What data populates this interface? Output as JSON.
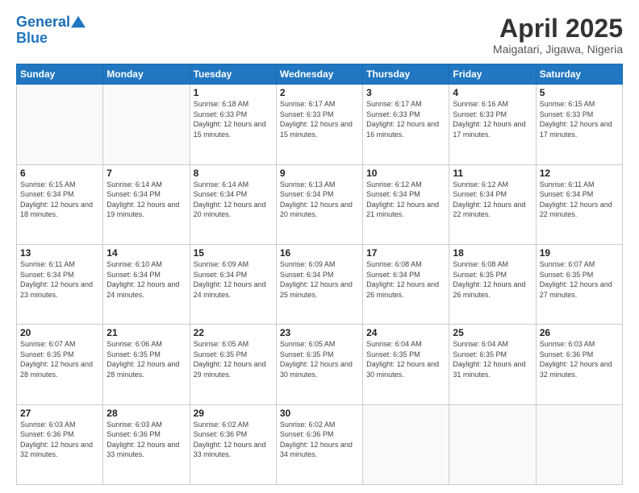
{
  "header": {
    "logo_line1": "General",
    "logo_line2": "Blue",
    "title": "April 2025",
    "subtitle": "Maigatari, Jigawa, Nigeria"
  },
  "calendar": {
    "headers": [
      "Sunday",
      "Monday",
      "Tuesday",
      "Wednesday",
      "Thursday",
      "Friday",
      "Saturday"
    ],
    "weeks": [
      [
        {
          "day": "",
          "info": ""
        },
        {
          "day": "",
          "info": ""
        },
        {
          "day": "1",
          "info": "Sunrise: 6:18 AM\nSunset: 6:33 PM\nDaylight: 12 hours and 15 minutes."
        },
        {
          "day": "2",
          "info": "Sunrise: 6:17 AM\nSunset: 6:33 PM\nDaylight: 12 hours and 15 minutes."
        },
        {
          "day": "3",
          "info": "Sunrise: 6:17 AM\nSunset: 6:33 PM\nDaylight: 12 hours and 16 minutes."
        },
        {
          "day": "4",
          "info": "Sunrise: 6:16 AM\nSunset: 6:33 PM\nDaylight: 12 hours and 17 minutes."
        },
        {
          "day": "5",
          "info": "Sunrise: 6:15 AM\nSunset: 6:33 PM\nDaylight: 12 hours and 17 minutes."
        }
      ],
      [
        {
          "day": "6",
          "info": "Sunrise: 6:15 AM\nSunset: 6:34 PM\nDaylight: 12 hours and 18 minutes."
        },
        {
          "day": "7",
          "info": "Sunrise: 6:14 AM\nSunset: 6:34 PM\nDaylight: 12 hours and 19 minutes."
        },
        {
          "day": "8",
          "info": "Sunrise: 6:14 AM\nSunset: 6:34 PM\nDaylight: 12 hours and 20 minutes."
        },
        {
          "day": "9",
          "info": "Sunrise: 6:13 AM\nSunset: 6:34 PM\nDaylight: 12 hours and 20 minutes."
        },
        {
          "day": "10",
          "info": "Sunrise: 6:12 AM\nSunset: 6:34 PM\nDaylight: 12 hours and 21 minutes."
        },
        {
          "day": "11",
          "info": "Sunrise: 6:12 AM\nSunset: 6:34 PM\nDaylight: 12 hours and 22 minutes."
        },
        {
          "day": "12",
          "info": "Sunrise: 6:11 AM\nSunset: 6:34 PM\nDaylight: 12 hours and 22 minutes."
        }
      ],
      [
        {
          "day": "13",
          "info": "Sunrise: 6:11 AM\nSunset: 6:34 PM\nDaylight: 12 hours and 23 minutes."
        },
        {
          "day": "14",
          "info": "Sunrise: 6:10 AM\nSunset: 6:34 PM\nDaylight: 12 hours and 24 minutes."
        },
        {
          "day": "15",
          "info": "Sunrise: 6:09 AM\nSunset: 6:34 PM\nDaylight: 12 hours and 24 minutes."
        },
        {
          "day": "16",
          "info": "Sunrise: 6:09 AM\nSunset: 6:34 PM\nDaylight: 12 hours and 25 minutes."
        },
        {
          "day": "17",
          "info": "Sunrise: 6:08 AM\nSunset: 6:34 PM\nDaylight: 12 hours and 26 minutes."
        },
        {
          "day": "18",
          "info": "Sunrise: 6:08 AM\nSunset: 6:35 PM\nDaylight: 12 hours and 26 minutes."
        },
        {
          "day": "19",
          "info": "Sunrise: 6:07 AM\nSunset: 6:35 PM\nDaylight: 12 hours and 27 minutes."
        }
      ],
      [
        {
          "day": "20",
          "info": "Sunrise: 6:07 AM\nSunset: 6:35 PM\nDaylight: 12 hours and 28 minutes."
        },
        {
          "day": "21",
          "info": "Sunrise: 6:06 AM\nSunset: 6:35 PM\nDaylight: 12 hours and 28 minutes."
        },
        {
          "day": "22",
          "info": "Sunrise: 6:05 AM\nSunset: 6:35 PM\nDaylight: 12 hours and 29 minutes."
        },
        {
          "day": "23",
          "info": "Sunrise: 6:05 AM\nSunset: 6:35 PM\nDaylight: 12 hours and 30 minutes."
        },
        {
          "day": "24",
          "info": "Sunrise: 6:04 AM\nSunset: 6:35 PM\nDaylight: 12 hours and 30 minutes."
        },
        {
          "day": "25",
          "info": "Sunrise: 6:04 AM\nSunset: 6:35 PM\nDaylight: 12 hours and 31 minutes."
        },
        {
          "day": "26",
          "info": "Sunrise: 6:03 AM\nSunset: 6:36 PM\nDaylight: 12 hours and 32 minutes."
        }
      ],
      [
        {
          "day": "27",
          "info": "Sunrise: 6:03 AM\nSunset: 6:36 PM\nDaylight: 12 hours and 32 minutes."
        },
        {
          "day": "28",
          "info": "Sunrise: 6:03 AM\nSunset: 6:36 PM\nDaylight: 12 hours and 33 minutes."
        },
        {
          "day": "29",
          "info": "Sunrise: 6:02 AM\nSunset: 6:36 PM\nDaylight: 12 hours and 33 minutes."
        },
        {
          "day": "30",
          "info": "Sunrise: 6:02 AM\nSunset: 6:36 PM\nDaylight: 12 hours and 34 minutes."
        },
        {
          "day": "",
          "info": ""
        },
        {
          "day": "",
          "info": ""
        },
        {
          "day": "",
          "info": ""
        }
      ]
    ]
  }
}
